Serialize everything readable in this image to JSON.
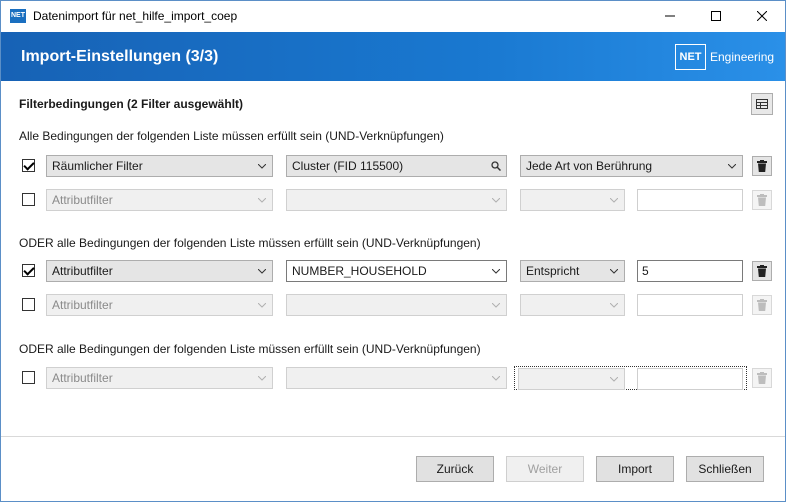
{
  "window": {
    "title": "Datenimport für net_hilfe_import_coep",
    "icon_label": "NET"
  },
  "header": {
    "title": "Import-Einstellungen (3/3)",
    "logo_box": "NET",
    "logo_text": "Engineering"
  },
  "filters": {
    "heading": "Filterbedingungen (2 Filter ausgewählt)",
    "groups": [
      {
        "label": "Alle Bedingungen der folgenden Liste müssen erfüllt sein (UND-Verknüpfungen)",
        "rows": [
          {
            "checked": true,
            "type": "Räumlicher Filter",
            "field": "Cluster (FID 115500)",
            "operator": "Jede Art von Berührung",
            "value": ""
          },
          {
            "checked": false,
            "type": "Attributfilter",
            "field": "",
            "operator": "",
            "value": ""
          }
        ]
      },
      {
        "label": "ODER alle Bedingungen der folgenden Liste müssen erfüllt sein (UND-Verknüpfungen)",
        "rows": [
          {
            "checked": true,
            "type": "Attributfilter",
            "field": "NUMBER_HOUSEHOLD",
            "operator": "Entspricht",
            "value": "5"
          },
          {
            "checked": false,
            "type": "Attributfilter",
            "field": "",
            "operator": "",
            "value": ""
          }
        ]
      },
      {
        "label": "ODER alle Bedingungen der folgenden Liste müssen erfüllt sein (UND-Verknüpfungen)",
        "rows": [
          {
            "checked": false,
            "type": "Attributfilter",
            "field": "",
            "operator": "",
            "value": ""
          }
        ]
      }
    ]
  },
  "footer": {
    "back": "Zurück",
    "next": "Weiter",
    "import": "Import",
    "close": "Schließen"
  },
  "icons": {
    "search": "search-icon",
    "delete": "trash-icon",
    "grid": "table-grid-icon",
    "dropdown": "chevron-down-icon"
  }
}
